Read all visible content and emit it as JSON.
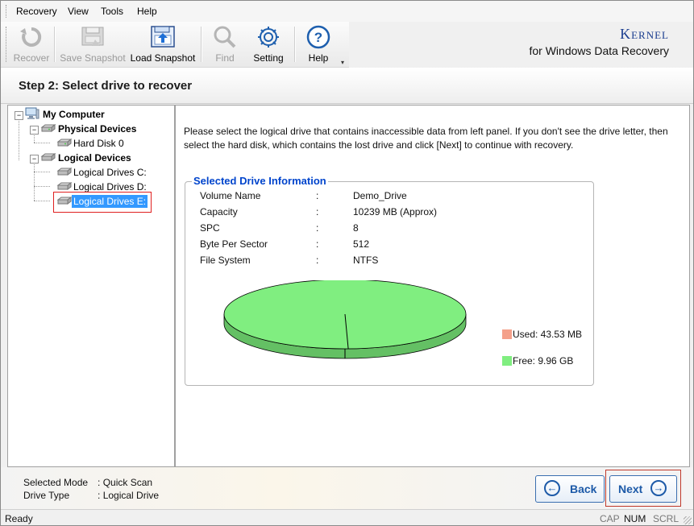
{
  "menu": [
    "Recovery",
    "View",
    "Tools",
    "Help"
  ],
  "toolbar": {
    "recover": "Recover",
    "save_snapshot": "Save Snapshot",
    "load_snapshot": "Load Snapshot",
    "find": "Find",
    "setting": "Setting",
    "help": "Help"
  },
  "brand": {
    "name": "Kernel",
    "tagline": "for Windows Data Recovery"
  },
  "step_title": "Step 2: Select drive to recover",
  "tree": {
    "root": "My Computer",
    "physical": "Physical Devices",
    "hard_disk": "Hard Disk 0",
    "logical": "Logical Devices",
    "drive_c": "Logical Drives C:",
    "drive_d": "Logical Drives D:",
    "drive_e": "Logical Drives E:"
  },
  "instruction": "Please select the logical drive that contains inaccessible data from left panel. If you don't see the drive letter, then select the hard disk, which contains the lost drive and click [Next] to continue with recovery.",
  "drive_info": {
    "legend": "Selected Drive Information",
    "rows": [
      {
        "key": "Volume Name",
        "sep": ":",
        "value": "Demo_Drive"
      },
      {
        "key": "Capacity",
        "sep": ":",
        "value": "10239 MB (Approx)"
      },
      {
        "key": "SPC",
        "sep": ":",
        "value": "8"
      },
      {
        "key": "Byte Per Sector",
        "sep": ":",
        "value": "512"
      },
      {
        "key": "File System",
        "sep": ":",
        "value": "NTFS"
      }
    ],
    "used_label": "Used: 43.53 MB",
    "free_label": "Free: 9.96 GB",
    "used_color": "#f4a08a",
    "free_color": "#80ee80",
    "used_fraction": 0.0043
  },
  "mode": {
    "mode_key": "Selected Mode",
    "mode_sep": ":",
    "mode_value": "Quick Scan",
    "type_key": "Drive Type",
    "type_sep": ":",
    "type_value": "Logical Drive"
  },
  "buttons": {
    "back": "Back",
    "next": "Next"
  },
  "status": {
    "text": "Ready",
    "cap": "CAP",
    "num": "NUM",
    "scrl": "SCRL"
  }
}
